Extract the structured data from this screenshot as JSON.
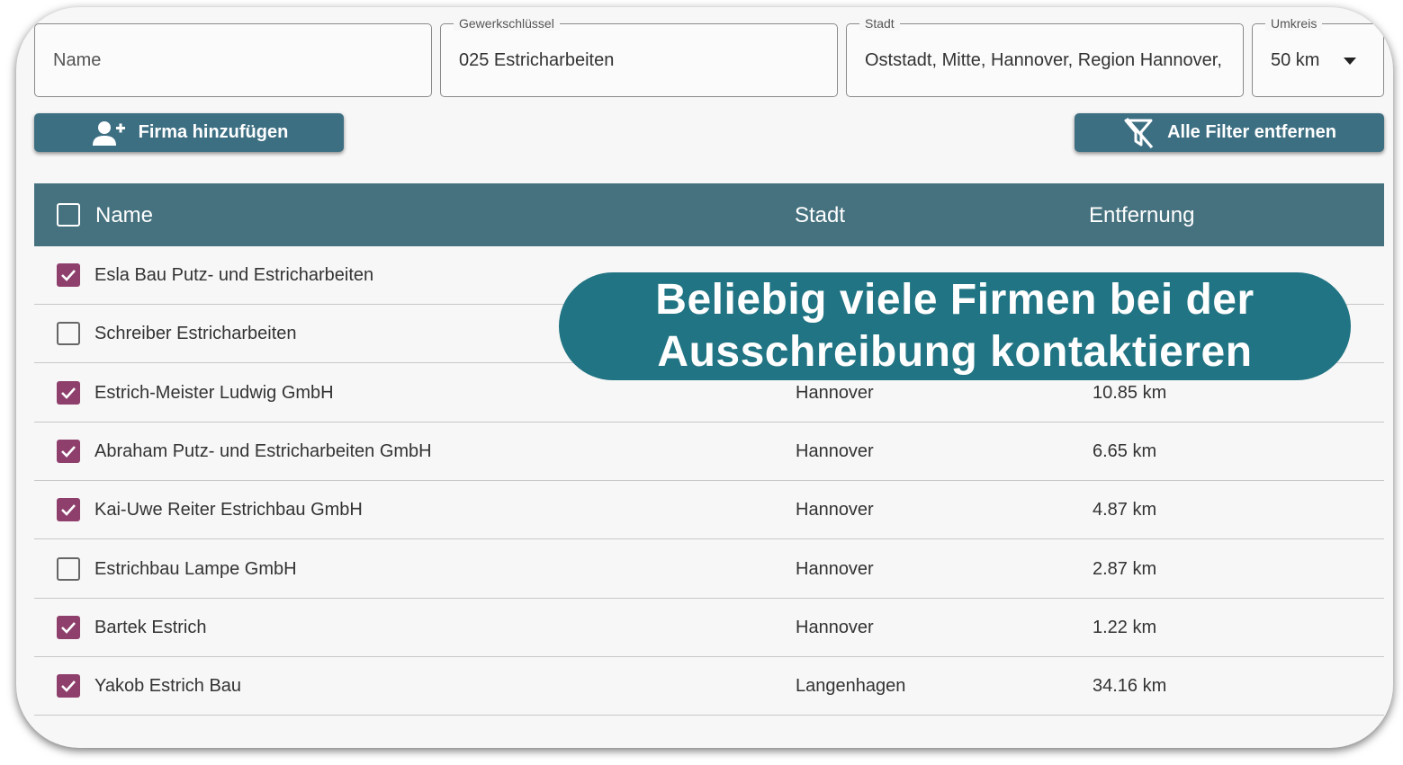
{
  "filters": {
    "name": {
      "placeholder": "Name"
    },
    "trade": {
      "label": "Gewerkschlüssel",
      "value": "025 Estricharbeiten"
    },
    "city": {
      "label": "Stadt",
      "value": "Oststadt, Mitte, Hannover, Region Hannover,"
    },
    "radius": {
      "label": "Umkreis",
      "value": "50 km"
    }
  },
  "toolbar": {
    "add_company_label": "Firma hinzufügen",
    "clear_filters_label": "Alle Filter entfernen"
  },
  "table": {
    "headers": {
      "name": "Name",
      "city": "Stadt",
      "distance": "Entfernung"
    },
    "rows": [
      {
        "name": "Esla Bau Putz- und Estricharbeiten",
        "city": "",
        "distance": "",
        "checked": true
      },
      {
        "name": "Schreiber Estricharbeiten",
        "city": "",
        "distance": "",
        "checked": false
      },
      {
        "name": "Estrich-Meister Ludwig GmbH",
        "city": "Hannover",
        "distance": "10.85 km",
        "checked": true
      },
      {
        "name": "Abraham Putz- und Estricharbeiten GmbH",
        "city": "Hannover",
        "distance": "6.65 km",
        "checked": true
      },
      {
        "name": "Kai-Uwe Reiter Estrichbau GmbH",
        "city": "Hannover",
        "distance": "4.87 km",
        "checked": true
      },
      {
        "name": "Estrichbau Lampe GmbH",
        "city": "Hannover",
        "distance": "2.87 km",
        "checked": false
      },
      {
        "name": "Bartek Estrich",
        "city": "Hannover",
        "distance": "1.22 km",
        "checked": true
      },
      {
        "name": "Yakob Estrich Bau",
        "city": "Langenhagen",
        "distance": "34.16 km",
        "checked": true
      }
    ]
  },
  "banner": {
    "line1": "Beliebig viele Firmen bei der",
    "line2": "Ausschreibung kontaktieren"
  },
  "colors": {
    "primary": "#3d6f83",
    "header": "#46727f",
    "checkbox": "#8e3f6c",
    "banner": "#217483"
  },
  "icons": {
    "add_company": "person-add-icon",
    "clear_filters": "filter-off-icon",
    "radius_dropdown": "caret-down-icon",
    "checkbox_checked": "check-icon"
  }
}
